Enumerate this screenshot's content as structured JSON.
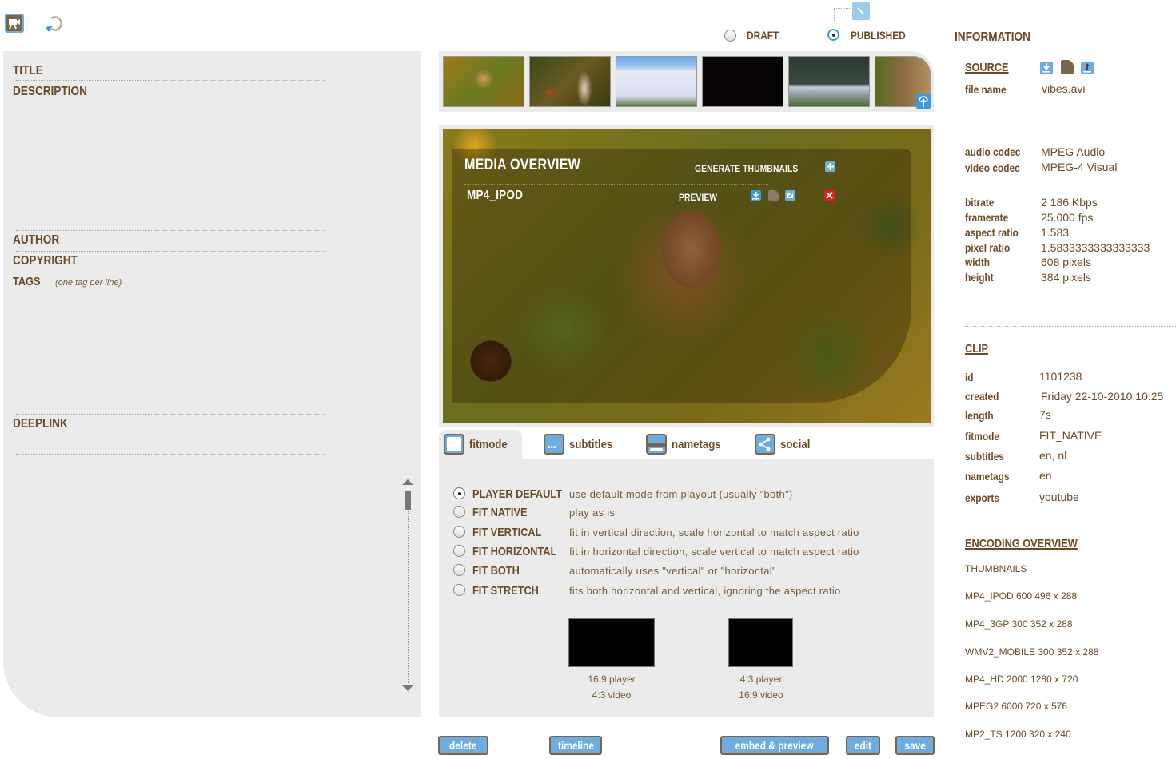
{
  "toolbar": {
    "icons": [
      "camera-icon",
      "refresh-icon"
    ]
  },
  "status": {
    "options": [
      {
        "label": "DRAFT",
        "selected": false
      },
      {
        "label": "PUBLISHED",
        "selected": true
      }
    ],
    "schedule_icon": "clock-icon"
  },
  "metadata_form": {
    "title_label": "TITLE",
    "description_label": "DESCRIPTION",
    "author_label": "AUTHOR",
    "copyright_label": "COPYRIGHT",
    "tags_label": "TAGS",
    "tags_hint": "(one tag per line)",
    "deeplink_label": "DEEPLINK"
  },
  "thumbnails": {
    "count_visible": 6,
    "upload_icon": "upload-icon"
  },
  "media_overview": {
    "title": "MEDIA OVERVIEW",
    "generate_label": "GENERATE THUMBNAILS",
    "encoding_name": "MP4_IPOD",
    "preview_label": "PREVIEW"
  },
  "tabs": [
    {
      "label": "fitmode",
      "icon": "window-icon",
      "active": true
    },
    {
      "label": "subtitles",
      "icon": "subtitles-icon",
      "active": false
    },
    {
      "label": "nametags",
      "icon": "nametag-icon",
      "active": false
    },
    {
      "label": "social",
      "icon": "share-icon",
      "active": false
    }
  ],
  "fitmode": {
    "options": [
      {
        "name": "PLAYER DEFAULT",
        "desc": "use default mode from playout (usually \"both\")",
        "selected": true
      },
      {
        "name": "FIT NATIVE",
        "desc": "play as is",
        "selected": false
      },
      {
        "name": "FIT VERTICAL",
        "desc": "fit in vertical direction, scale horizontal to match aspect ratio",
        "selected": false
      },
      {
        "name": "FIT HORIZONTAL",
        "desc": "fit in horizontal direction, scale vertical to match aspect ratio",
        "selected": false
      },
      {
        "name": "FIT BOTH",
        "desc": "automatically uses \"vertical\" or \"horizontal\"",
        "selected": false
      },
      {
        "name": "FIT STRETCH",
        "desc": "fits both horizontal and vertical, ignoring the aspect ratio",
        "selected": false
      }
    ],
    "previews": [
      {
        "line1": "16:9  player",
        "line2": "4:3  video"
      },
      {
        "line1": "4:3  player",
        "line2": "16:9  video"
      }
    ]
  },
  "buttons": {
    "delete": "delete",
    "timeline": "timeline",
    "embed": "embed & preview",
    "edit": "edit",
    "save": "save"
  },
  "information": {
    "heading": "INFORMATION",
    "source": {
      "heading": "SOURCE",
      "icons": [
        "download-icon",
        "tag-icon",
        "upload-icon"
      ],
      "file_name_label": "file name",
      "file_name": "vibes.avi",
      "rows1": [
        {
          "key": "audio codec",
          "value": "MPEG Audio"
        },
        {
          "key": "video codec",
          "value": "MPEG-4 Visual"
        }
      ],
      "rows2": [
        {
          "key": "bitrate",
          "value": "2 186 Kbps"
        },
        {
          "key": "framerate",
          "value": "25.000 fps"
        },
        {
          "key": "aspect ratio",
          "value": "1.583"
        },
        {
          "key": "pixel ratio",
          "value": "1.5833333333333333"
        },
        {
          "key": "width",
          "value": "608 pixels"
        },
        {
          "key": "height",
          "value": "384 pixels"
        }
      ]
    },
    "clip": {
      "heading": "CLIP",
      "rows": [
        {
          "key": "id",
          "value": "1101238"
        },
        {
          "key": "created",
          "value": "Friday 22-10-2010 10:25"
        },
        {
          "key": "length",
          "value": "7s"
        },
        {
          "key": "fitmode",
          "value": "FIT_NATIVE"
        },
        {
          "key": "subtitles",
          "value": "en, nl"
        },
        {
          "key": "nametags",
          "value": "en"
        },
        {
          "key": "exports",
          "value": "youtube"
        }
      ]
    },
    "encoding": {
      "heading": "ENCODING OVERVIEW",
      "items": [
        "THUMBNAILS",
        "MP4_IPOD 600 496 x 288",
        "MP4_3GP 300 352 x 288",
        "WMV2_MOBILE 300 352 x 288",
        "MP4_HD 2000 1280 x 720",
        "MPEG2 6000 720 x 576",
        "MP2_TS 1200 320 x 240"
      ]
    }
  }
}
